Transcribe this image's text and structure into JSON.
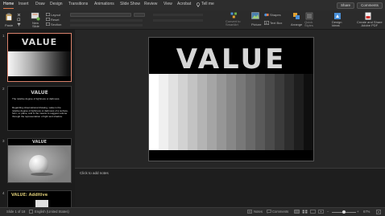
{
  "ribbon_tabs": [
    {
      "label": "Home",
      "active": true
    },
    {
      "label": "Insert"
    },
    {
      "label": "Draw"
    },
    {
      "label": "Design"
    },
    {
      "label": "Transitions"
    },
    {
      "label": "Animations"
    },
    {
      "label": "Slide Show"
    },
    {
      "label": "Review"
    },
    {
      "label": "View"
    },
    {
      "label": "Acrobat"
    },
    {
      "label": "Tell me"
    }
  ],
  "header_buttons": {
    "share": "Share",
    "comments": "Comments"
  },
  "ribbon": {
    "paste": "Paste",
    "new_slide": "New\nSlide",
    "layout": "Layout",
    "reset": "Reset",
    "section": "Section",
    "convert_smartart": "Convert to\nSmartArt",
    "picture": "Picture",
    "shapes": "Shapes",
    "text_box": "Text Box",
    "arrange": "Arrange",
    "quick_styles": "Quick\nStyles",
    "design_ideas": "Design\nIdeas",
    "create_pdf": "Create and Share\nAdobe PDF"
  },
  "slides": [
    {
      "num": "1",
      "title": "VALUE"
    },
    {
      "num": "2",
      "title": "VALUE",
      "text_1": "The relative degree of lightness or darkness.",
      "text_2": "Regarding observational drawing, value is the relative degree of lightness or darkness of a surface, form, or plane, and is the means to suggest volume through the representation of light and shadow."
    },
    {
      "num": "3",
      "title": "VALUE"
    },
    {
      "num": "4",
      "title": "VALUE: Additive"
    }
  ],
  "main_slide": {
    "title": "VALUE"
  },
  "notes_placeholder": "Click to add notes",
  "status": {
    "slide_info": "Slide 1 of 18",
    "language": "English (United States)",
    "notes": "Notes",
    "comments": "Comments",
    "zoom": "67%"
  },
  "colors": {
    "accent": "#e07a4a",
    "selection": "#d9826c"
  }
}
